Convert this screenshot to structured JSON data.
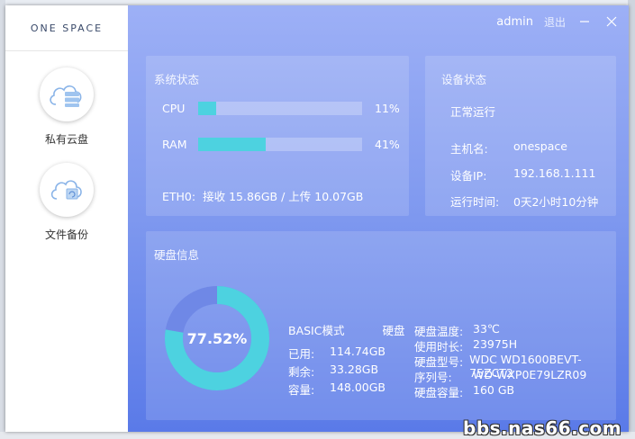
{
  "app": {
    "logo_text": "ONE SPACE"
  },
  "topbar": {
    "user": "admin",
    "logout": "退出"
  },
  "sidebar": {
    "items": [
      {
        "label": "私有云盘",
        "icon": "cloud-server-icon"
      },
      {
        "label": "文件备份",
        "icon": "cloud-backup-icon"
      }
    ]
  },
  "system": {
    "title": "系统状态",
    "cpu": {
      "label": "CPU",
      "value": "11%",
      "percent": 11
    },
    "ram": {
      "label": "RAM",
      "value": "41%",
      "percent": 41
    },
    "eth": {
      "label": "ETH0:",
      "text": "接收 15.86GB / 上传 10.07GB"
    }
  },
  "device": {
    "title": "设备状态",
    "status": "正常运行",
    "host_label": "主机名:",
    "host_value": "onespace",
    "ip_label": "设备IP:",
    "ip_value": "192.168.1.111",
    "uptime_label": "运行时间:",
    "uptime_value": "0天2小时10分钟"
  },
  "disk": {
    "title": "硬盘信息",
    "usage_percent": 77.52,
    "usage_text": "77.52%",
    "mode": "BASIC模式",
    "disk_word": "硬盘",
    "used_label": "已用:",
    "used_value": "114.74GB",
    "free_label": "剩余:",
    "free_value": "33.28GB",
    "capacity_label": "容量:",
    "capacity_value": "148.00GB",
    "temp_label": "硬盘温度:",
    "temp_value": "33℃",
    "hours_label": "使用时长:",
    "hours_value": "23975H",
    "model_label": "硬盘型号:",
    "model_value": "WDC WD1600BEVT-75ZCT2",
    "serial_label": "序列号:",
    "serial_value": "WD-WXP0E79LZR09",
    "size_label": "硬盘容量:",
    "size_value": "160 GB"
  },
  "colors": {
    "accent": "#4dd2e0",
    "donut_track": "#6f88e6"
  },
  "watermark": "bbs.nas66.com"
}
